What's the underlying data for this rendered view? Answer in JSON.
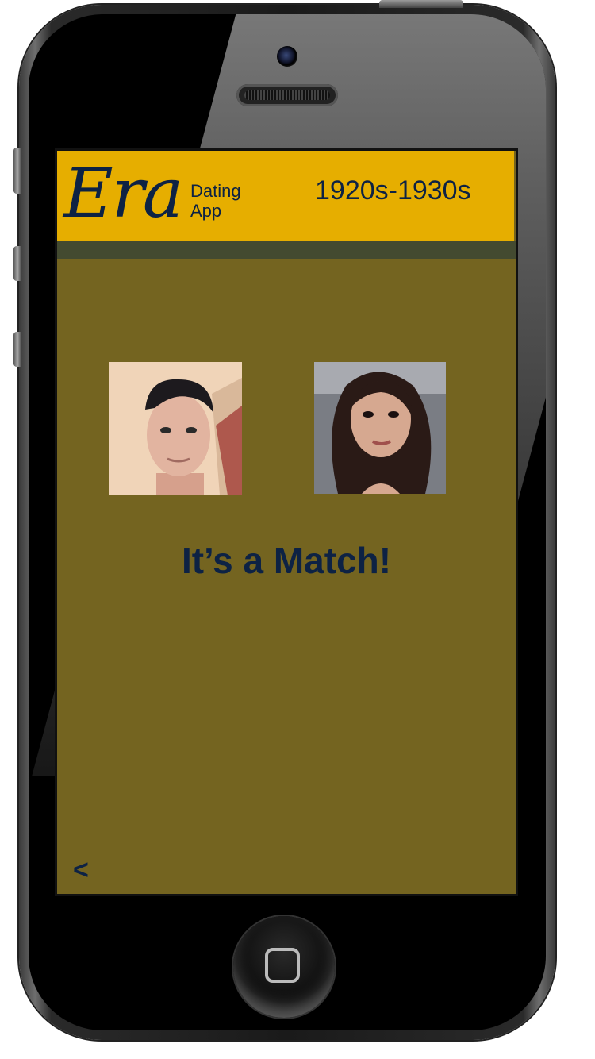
{
  "header": {
    "logo_text": "Era",
    "logo_subtitle_line1": "Dating",
    "logo_subtitle_line2": "App",
    "era_range": "1920s-1930s"
  },
  "match": {
    "title": "It’s a Match!",
    "left_photo": "user-photo",
    "right_photo": "match-photo"
  },
  "navigation": {
    "back_label": "<"
  },
  "colors": {
    "header_bg": "#e6ae00",
    "screen_bg": "#746420",
    "subbar_bg": "#434a30",
    "text_navy": "#0d2244"
  }
}
